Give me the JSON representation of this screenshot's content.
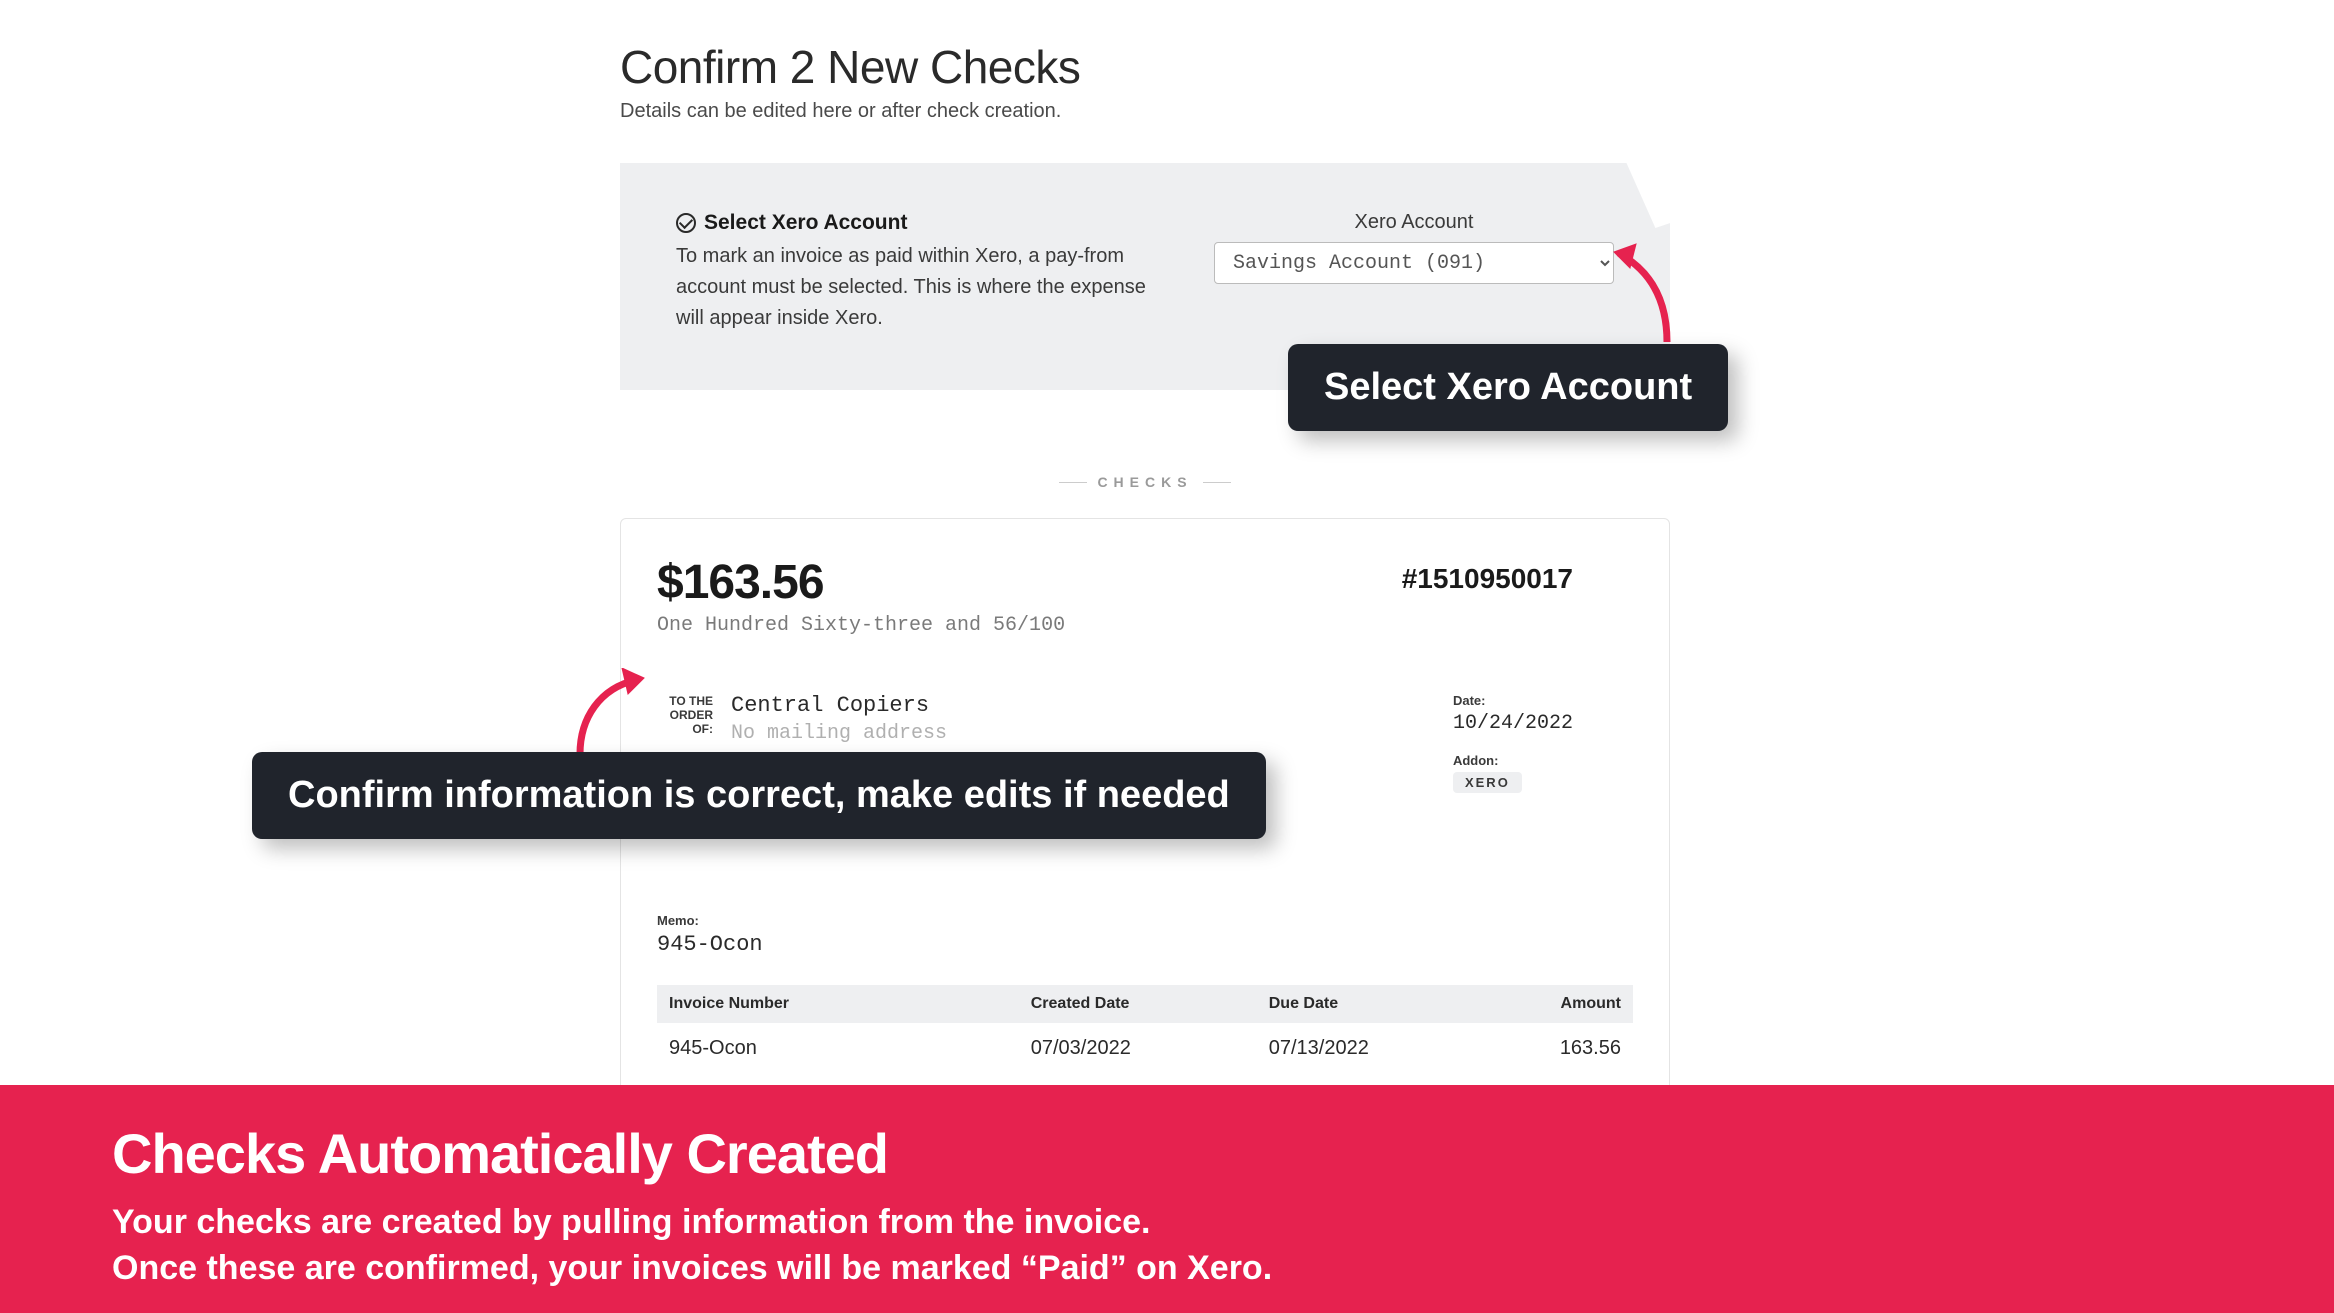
{
  "header": {
    "title": "Confirm 2 New Checks",
    "subtitle": "Details can be edited here or after check creation."
  },
  "xero_panel": {
    "heading": "Select Xero Account",
    "desc": "To mark an invoice as paid within Xero, a pay-from account must be selected. This is where the expense will appear inside Xero.",
    "select_label": "Xero Account",
    "select_value": "Savings Account (091)"
  },
  "divider_label": "CHECKS",
  "check": {
    "amount": "$163.56",
    "amount_words": "One Hundred Sixty-three and 56/100",
    "number": "#1510950017",
    "order_label": "TO THE ORDER OF:",
    "payee": "Central Copiers",
    "mailing": "No mailing address",
    "date_label": "Date:",
    "date_value": "10/24/2022",
    "addon_label": "Addon:",
    "addon_value": "XERO",
    "memo_label": "Memo:",
    "memo_value": "945-Ocon"
  },
  "table": {
    "headers": {
      "c1": "Invoice Number",
      "c2": "Created Date",
      "c3": "Due Date",
      "c4": "Amount"
    },
    "row": {
      "c1": "945-Ocon",
      "c2": "07/03/2022",
      "c3": "07/13/2022",
      "c4": "163.56"
    }
  },
  "callouts": {
    "account": "Select Xero Account",
    "confirm": "Confirm information is correct, make edits if needed"
  },
  "banner": {
    "title": "Checks Automatically Created",
    "line1": "Your checks are created by pulling information from the invoice.",
    "line2": "Once these are confirmed, your invoices will be marked “Paid” on Xero."
  }
}
